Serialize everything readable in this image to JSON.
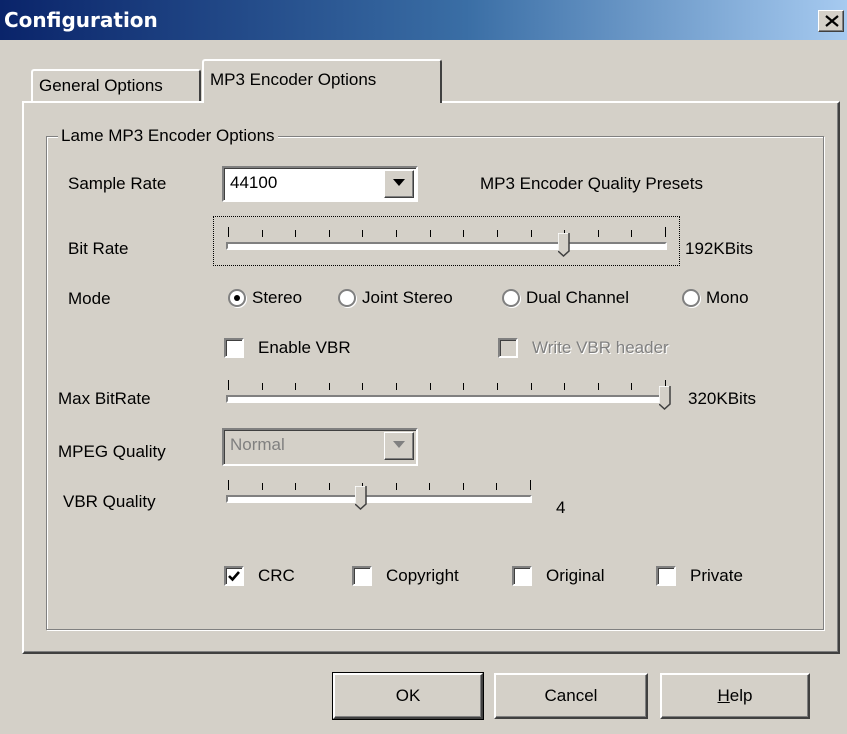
{
  "window": {
    "title": "Configuration"
  },
  "tabs": [
    {
      "label": "General Options",
      "active": false
    },
    {
      "label": "MP3 Encoder Options",
      "active": true
    }
  ],
  "group": {
    "label": "Lame MP3 Encoder Options"
  },
  "sample_rate": {
    "label": "Sample Rate",
    "value": "44100"
  },
  "presets_label": "MP3 Encoder Quality Presets",
  "bit_rate": {
    "label": "Bit Rate",
    "value_text": "192KBits",
    "fraction": 0.77
  },
  "mode": {
    "label": "Mode",
    "options": [
      {
        "label": "Stereo",
        "selected": true
      },
      {
        "label": "Joint Stereo",
        "selected": false
      },
      {
        "label": "Dual Channel",
        "selected": false
      },
      {
        "label": "Mono",
        "selected": false
      }
    ]
  },
  "enable_vbr": {
    "label": "Enable VBR",
    "checked": false
  },
  "write_vbr_header": {
    "label": "Write VBR header",
    "checked": false,
    "disabled": true
  },
  "max_bitrate": {
    "label": "Max BitRate",
    "value_text": "320KBits",
    "fraction": 1.0
  },
  "mpeg_quality": {
    "label": "MPEG Quality",
    "value": "Normal",
    "disabled": true
  },
  "vbr_quality": {
    "label": "VBR Quality",
    "value_text": "4",
    "fraction": 0.44
  },
  "flags": [
    {
      "label": "CRC",
      "checked": true
    },
    {
      "label": "Copyright",
      "checked": false
    },
    {
      "label": "Original",
      "checked": false
    },
    {
      "label": "Private",
      "checked": false
    }
  ],
  "buttons": {
    "ok": "OK",
    "cancel": "Cancel",
    "help_prefix": "H",
    "help_rest": "elp"
  },
  "colors": {
    "titlebar_start": "#0a246a",
    "titlebar_end": "#a6caf0",
    "face": "#d4d0c8"
  }
}
